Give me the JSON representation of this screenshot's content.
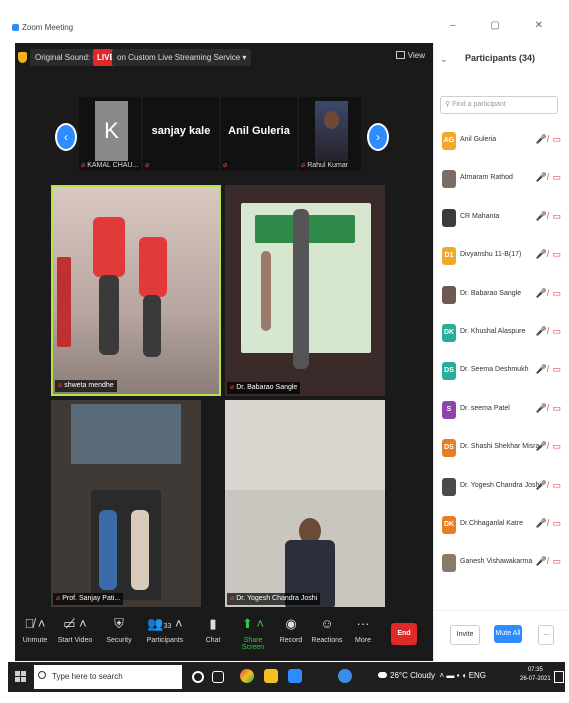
{
  "window": {
    "app_title": "Zoom Meeting"
  },
  "topbar": {
    "sound_label": "Original Sound: On",
    "live_label": "LIVE",
    "stream_label": "on Custom Live Streaming Service",
    "view_label": "View"
  },
  "thumbnails": [
    {
      "display": "K",
      "name": "KAMAL CHAU..."
    },
    {
      "display": "sanjay kale",
      "name": ""
    },
    {
      "display": "Anil Guleria",
      "name": ""
    },
    {
      "display": "",
      "name": "Rahul Kumar"
    }
  ],
  "tiles": [
    {
      "name": "shweta mendhe"
    },
    {
      "name": "Dr. Babarao Sangle"
    },
    {
      "name": "Prof. Sanjay Pati..."
    },
    {
      "name": "Dr. Yogesh Chandra Joshi"
    }
  ],
  "controls": {
    "unmute": "Unmute",
    "start_video": "Start Video",
    "security": "Security",
    "participants": "Participants",
    "participants_count": "33",
    "chat": "Chat",
    "share_screen": "Share Screen",
    "record": "Record",
    "reactions": "Reactions",
    "more": "More",
    "end": "End"
  },
  "panel": {
    "title": "Participants (34)",
    "search_placeholder": "Find a participant",
    "participants": [
      {
        "initials": "AG",
        "name": "Anil Guleria",
        "color": "#f2a82b",
        "status": "🎤̸ ▭"
      },
      {
        "initials": "",
        "name": "Atmaram Rathod",
        "color": "#7b6d63",
        "status": "🎤̸ ▭"
      },
      {
        "initials": "",
        "name": "CR Mahanta",
        "color": "#3c3c3c",
        "status": "🎤̸ ▭"
      },
      {
        "initials": "D1",
        "name": "Divyanshu 11-B(17)",
        "color": "#f2a82b",
        "status": "🎤̸ ▭"
      },
      {
        "initials": "",
        "name": "Dr. Babarao Sangle",
        "color": "#6d5b52",
        "status": "🎤̸ ▭"
      },
      {
        "initials": "DK",
        "name": "Dr. Khushal Alaspure",
        "color": "#27ae9a",
        "status": "🎤̸ ▭"
      },
      {
        "initials": "DS",
        "name": "Dr. Seema Deshmukh",
        "color": "#27ae9a",
        "status": "🎤̸ ▭"
      },
      {
        "initials": "S",
        "name": "Dr. seema Patel",
        "color": "#8e44ad",
        "status": "🎤̸ ▭"
      },
      {
        "initials": "DS",
        "name": "Dr. Shashi Shekhar Misra",
        "color": "#e67e22",
        "status": "🎤̸ ▭"
      },
      {
        "initials": "",
        "name": "Dr. Yogesh Chandra Joshi",
        "color": "#4a4a4a",
        "status": "🎤̸ ▭"
      },
      {
        "initials": "DK",
        "name": "Dr.Chhaganlal Katre",
        "color": "#e67e22",
        "status": "🎤̸ ▭"
      },
      {
        "initials": "",
        "name": "Ganesh Vishawakarma",
        "color": "#8a7a6a",
        "status": "🎤̸ ▭"
      }
    ],
    "invite": "Invite",
    "mute_all": "Mute All",
    "more": "..."
  },
  "taskbar": {
    "search_placeholder": "Type here to search",
    "weather": "26°C  Cloudy",
    "lang": "ENG",
    "time": "07:35",
    "date": "26-07-2021"
  }
}
